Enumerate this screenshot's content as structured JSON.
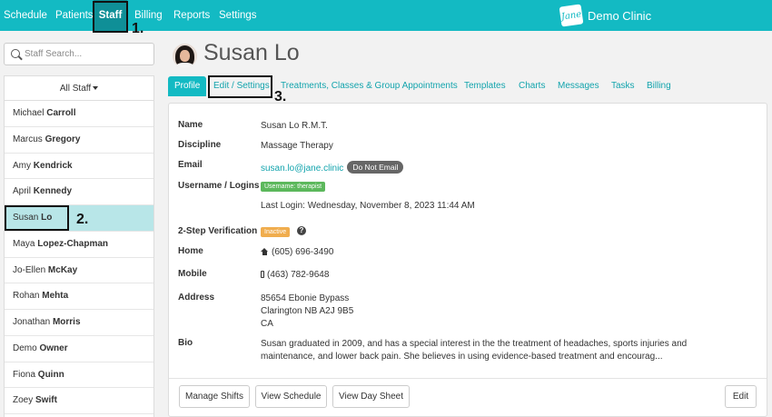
{
  "nav": {
    "items": [
      {
        "label": "Schedule"
      },
      {
        "label": "Patients"
      },
      {
        "label": "Staff",
        "active": true
      },
      {
        "label": "Billing"
      },
      {
        "label": "Reports"
      },
      {
        "label": "Settings"
      }
    ],
    "brand_logo": "Jane",
    "brand_name": "Demo Clinic"
  },
  "annotations": [
    "1.",
    "2.",
    "3."
  ],
  "sidebar": {
    "search_placeholder": "Staff Search...",
    "filter_label": "All Staff",
    "staff": [
      {
        "first": "Michael",
        "last": "Carroll"
      },
      {
        "first": "Marcus",
        "last": "Gregory"
      },
      {
        "first": "Amy",
        "last": "Kendrick"
      },
      {
        "first": "April",
        "last": "Kennedy"
      },
      {
        "first": "Susan",
        "last": "Lo",
        "selected": true
      },
      {
        "first": "Maya",
        "last": "Lopez-Chapman"
      },
      {
        "first": "Jo-Ellen",
        "last": "McKay"
      },
      {
        "first": "Rohan",
        "last": "Mehta"
      },
      {
        "first": "Jonathan",
        "last": "Morris"
      },
      {
        "first": "Demo",
        "last": "Owner"
      },
      {
        "first": "Fiona",
        "last": "Quinn"
      },
      {
        "first": "Zoey",
        "last": "Swift"
      }
    ]
  },
  "profile": {
    "name": "Susan Lo",
    "tabs": [
      "Profile",
      "Edit / Settings",
      "Treatments, Classes & Group Appointments",
      "Templates",
      "Charts",
      "Messages",
      "Tasks",
      "Billing"
    ],
    "fields": {
      "name_label": "Name",
      "name_value": "Susan Lo R.M.T.",
      "discipline_label": "Discipline",
      "discipline_value": "Massage Therapy",
      "email_label": "Email",
      "email_value": "susan.lo@jane.clinic",
      "email_badge": "Do Not Email",
      "username_label": "Username / Logins",
      "username_tag": "Username: therapist",
      "last_login": "Last Login: Wednesday, November 8, 2023 11:44 AM",
      "two_step_label": "2-Step Verification",
      "two_step_status": "Inactive",
      "home_label": "Home",
      "home_value": "(605) 696-3490",
      "mobile_label": "Mobile",
      "mobile_value": "(463) 782-9648",
      "address_label": "Address",
      "address_lines": [
        "85654 Ebonie Bypass",
        "Clarington NB A2J 9B5",
        "CA"
      ],
      "bio_label": "Bio",
      "bio_value": "Susan graduated in 2009, and has a special interest in the the treatment of headaches, sports injuries and maintenance, and lower back pain. She believes in using evidence-based treatment and encourag..."
    },
    "buttons": {
      "manage_shifts": "Manage Shifts",
      "view_schedule": "View Schedule",
      "view_day_sheet": "View Day Sheet",
      "edit": "Edit"
    }
  },
  "colors": {
    "brand": "#13bac3",
    "nav_active": "#0f8f97",
    "selected_row": "#b8e6e8",
    "link": "#13a4ad"
  }
}
